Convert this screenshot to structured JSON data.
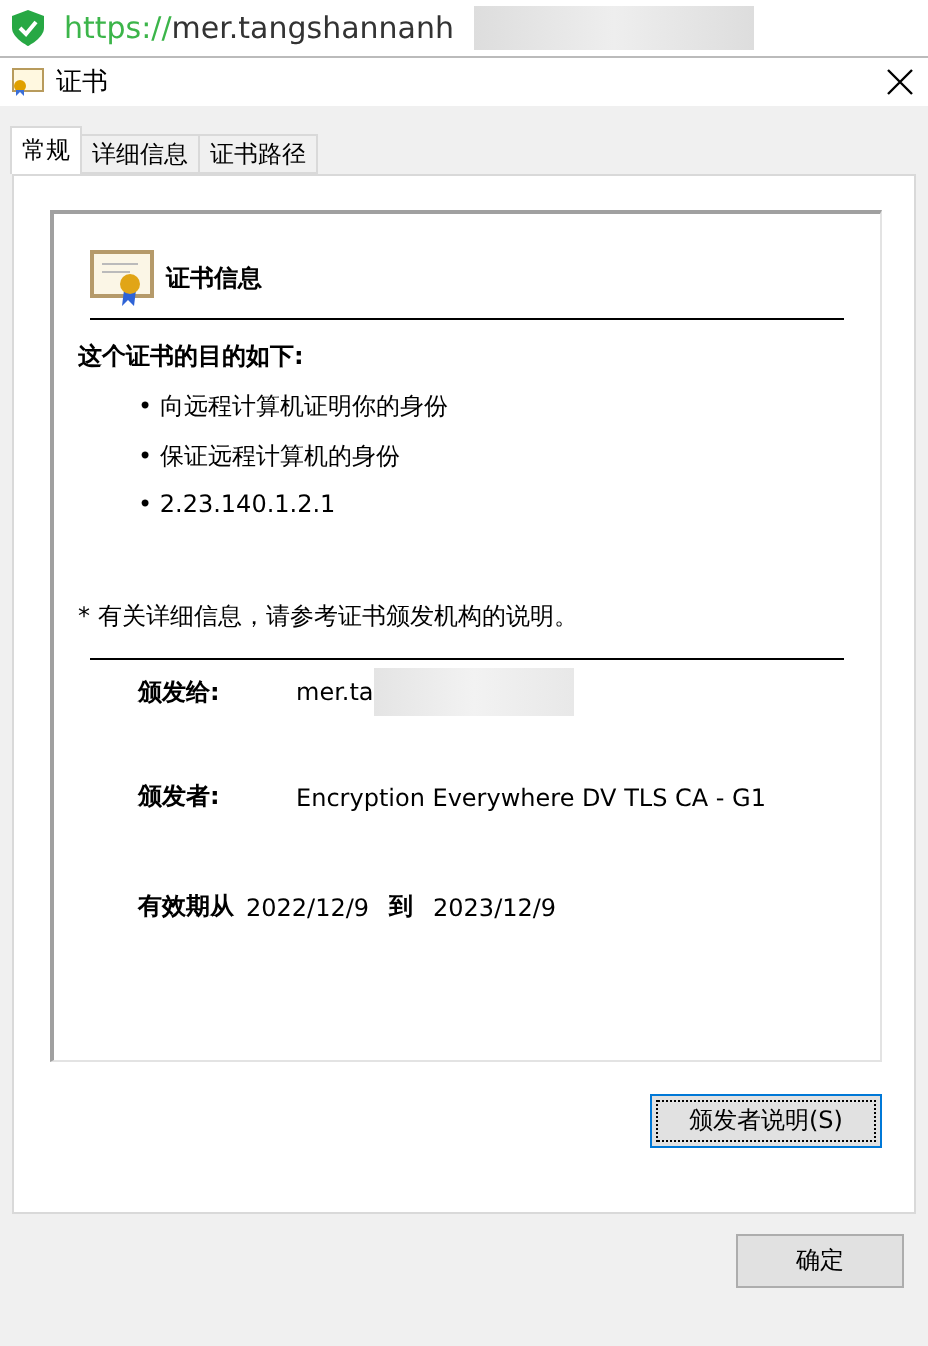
{
  "browser": {
    "url_scheme": "https://",
    "url_rest": "mer.tangshannanh"
  },
  "window": {
    "title": "证书"
  },
  "tabs": [
    {
      "label": "常规",
      "selected": true
    },
    {
      "label": "详细信息",
      "selected": false
    },
    {
      "label": "证书路径",
      "selected": false
    }
  ],
  "cert": {
    "heading": "证书信息",
    "purpose_title": "这个证书的目的如下:",
    "purposes": [
      "• 向远程计算机证明你的身份",
      "• 保证远程计算机的身份",
      "• 2.23.140.1.2.1"
    ],
    "note": "* 有关详细信息，请参考证书颁发机构的说明。",
    "issued_to_label": "颁发给:",
    "issued_to": "mer.ta",
    "issued_by_label": "颁发者:",
    "issued_by": "Encryption Everywhere DV TLS CA - G1",
    "valid_label": "有效期从",
    "valid_from": "2022/12/9",
    "valid_to_label": "到",
    "valid_to": "2023/12/9"
  },
  "issuer_button": "颁发者说明(S)",
  "ok_button": "确定"
}
